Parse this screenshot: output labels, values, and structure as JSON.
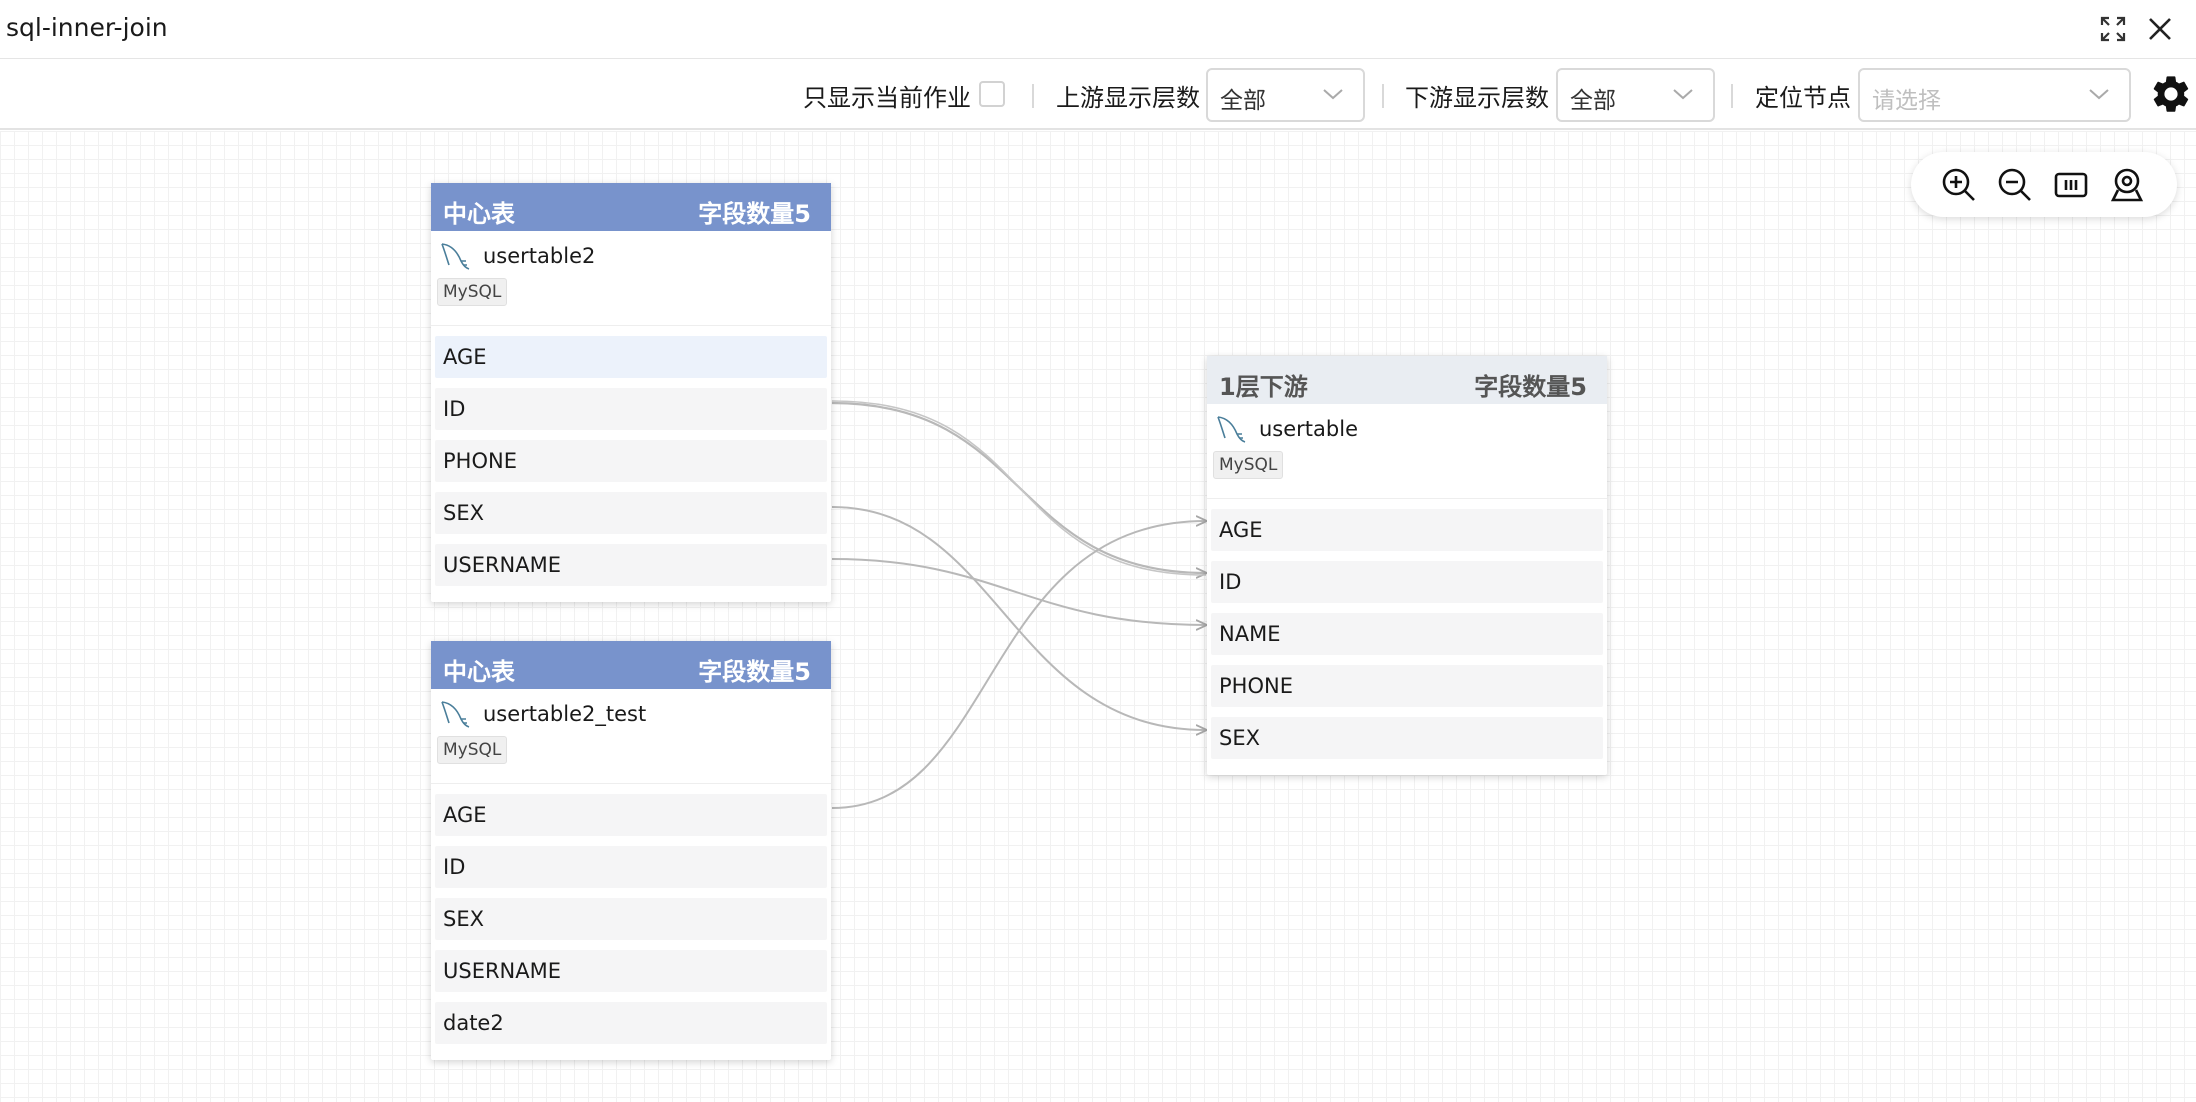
{
  "window": {
    "title": "sql-inner-join"
  },
  "toolbar": {
    "only_current_label": "只显示当前作业",
    "upstream_label": "上游显示层数",
    "upstream_value": "全部",
    "downstream_label": "下游显示层数",
    "downstream_value": "全部",
    "locate_label": "定位节点",
    "locate_placeholder": "请选择"
  },
  "icons": {
    "fullscreen": "fullscreen-icon",
    "close": "close-icon",
    "settings": "gear-icon",
    "zoom_in": "zoom-in-icon",
    "zoom_out": "zoom-out-icon",
    "fit": "fit-view-icon",
    "locate": "locate-icon",
    "db": "mysql-dolphin-icon"
  },
  "colors": {
    "center_header": "#7893cc",
    "downstream_header": "#e9edf2",
    "edge": "#b8b8b8"
  },
  "nodes": {
    "n1": {
      "type_label": "中心表",
      "count_label": "字段数量5",
      "table": "usertable2",
      "db": "MySQL",
      "fields": [
        "AGE",
        "ID",
        "PHONE",
        "SEX",
        "USERNAME"
      ]
    },
    "n2": {
      "type_label": "中心表",
      "count_label": "字段数量5",
      "table": "usertable2_test",
      "db": "MySQL",
      "fields": [
        "AGE",
        "ID",
        "SEX",
        "USERNAME",
        "date2"
      ]
    },
    "n3": {
      "type_label": "1层下游",
      "count_label": "字段数量5",
      "table": "usertable",
      "db": "MySQL",
      "fields": [
        "AGE",
        "ID",
        "NAME",
        "PHONE",
        "SEX"
      ]
    }
  },
  "edges": [
    {
      "from": "usertable2.ID",
      "to": "usertable.ID"
    },
    {
      "from": "usertable2.SEX",
      "to": "usertable.SEX"
    },
    {
      "from": "usertable2.USERNAME",
      "to": "usertable.NAME"
    },
    {
      "from": "usertable2_test.AGE",
      "to": "usertable.AGE"
    }
  ]
}
